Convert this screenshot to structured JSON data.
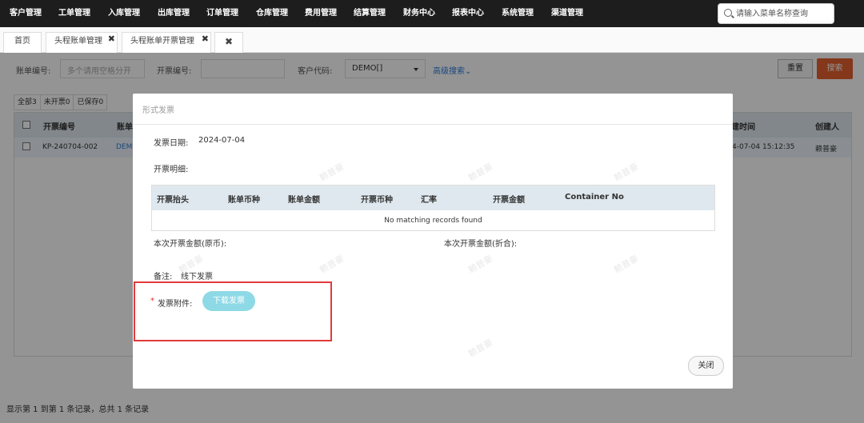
{
  "nav": {
    "items": [
      "客户管理",
      "工单管理",
      "入库管理",
      "出库管理",
      "订单管理",
      "仓库管理",
      "费用管理",
      "结算管理",
      "财务中心",
      "报表中心",
      "系统管理",
      "渠道管理"
    ],
    "search_placeholder": "请输入菜单名称查询"
  },
  "tabs": {
    "home": "首页",
    "tab1": "头程账单管理",
    "tab2": "头程账单开票管理",
    "close_icon": "✖"
  },
  "filter": {
    "bill_no_label": "账单编号:",
    "bill_no_placeholder": "多个请用空格分开",
    "invoice_no_label": "开票编号:",
    "customer_label": "客户代码:",
    "customer_value": "DEMO[]",
    "advanced": "高级搜索",
    "reset": "重置",
    "search": "搜索"
  },
  "status_tabs": [
    "全部3",
    "未开票0",
    "已保存0"
  ],
  "table": {
    "headers": {
      "invoice_no": "开票编号",
      "bill": "账单",
      "created_time": "建时间",
      "creator": "创建人"
    },
    "row": {
      "invoice_no": "KP-240704-002",
      "bill": "DEMO",
      "created_time": "4-07-04 15:12:35",
      "creator": "赖普豪"
    }
  },
  "pager": "显示第 1 到第 1 条记录，总共 1 条记录",
  "modal": {
    "title": "形式发票",
    "date_label": "发票日期:",
    "date_value": "2024-07-04",
    "detail_label": "开票明细:",
    "detail_headers": [
      "开票抬头",
      "账单币种",
      "账单金额",
      "开票币种",
      "汇率",
      "开票金额",
      "Container No"
    ],
    "empty_text": "No matching records found",
    "amount_orig_label": "本次开票金额(原币):",
    "amount_conv_label": "本次开票金额(折合):",
    "remark_label": "备注:",
    "remark_value": "线下发票",
    "attachment_required": "*",
    "attachment_label": "发票附件:",
    "download_button": "下载发票",
    "close_button": "关闭"
  },
  "watermark": "赖普豪",
  "colors": {
    "accent": "#e4602f",
    "highlight": "#e23a3a",
    "download": "#8ed9e6",
    "nav_bg": "#1d1d1d"
  }
}
